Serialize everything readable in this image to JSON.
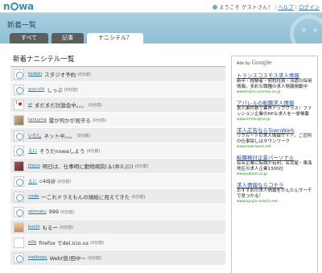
{
  "header": {
    "logo": "nowa",
    "greeting": "ようこそ ゲストさん！",
    "help_label": "ヘルプ",
    "login_label": "ログイン"
  },
  "band": {
    "title": "新着一覧"
  },
  "tabs": [
    {
      "label": "すべて"
    },
    {
      "label": "記事"
    },
    {
      "label": "ナニシテル？"
    }
  ],
  "main": {
    "section_title": "新着ナニシテル一覧",
    "items": [
      {
        "user": "todeki",
        "message": "スタジオ予約",
        "time": "(0分前)"
      },
      {
        "user": "yuu-chi",
        "message": "しっぷ",
        "time": "(0分前)"
      },
      {
        "user": "ai",
        "message": "まだまだ討論会中。。。",
        "time": "(0分前)"
      },
      {
        "user": "tatsuma",
        "message": "雷が何かが見守る",
        "time": "(0分前)"
      },
      {
        "user": "いわし",
        "message": "ネット中。。。",
        "time": "(0分前)"
      },
      {
        "user": "えに",
        "message": "そうだnowaしよう",
        "time": "(0分前)"
      },
      {
        "user": "jhoco",
        "message": "明日は、仕事明に動物病院(＆(弁)(ぷ))",
        "time": "(0分前)"
      },
      {
        "user": "えに",
        "message": "c4dj@",
        "time": "(0分前)"
      },
      {
        "user": "code",
        "message": "一これドラえもんの顔絵に見えてきた",
        "time": "(0分前)"
      },
      {
        "user": "akimaru",
        "message": "999",
        "time": "(0分前)"
      },
      {
        "user": "kochi",
        "message": "もるー",
        "time": "(0分前)"
      },
      {
        "user": "e0e",
        "message": "firefox でdel.icio.us",
        "time": "(0分前)"
      },
      {
        "user": "heiihoou",
        "message": "Web(仮)田中〜",
        "time": "(0分前)"
      }
    ]
  },
  "ads": {
    "header_prefix": "Ads by",
    "header_brand": "Google",
    "items": [
      {
        "title": "トランスコスモス求人情報",
        "body": "新卒・経験者・契約社員・派遣の採用情報。多彩な職種の求人情報掲載中",
        "url": "www.trans-cosmos.co.jp"
      },
      {
        "title": "アパレルの転職求人情報",
        "body": "求人案件数で業界トップクラス！ファッション企業のHP＆求人を一挙掲載",
        "url": "www.infoengine.jp"
      },
      {
        "title": "求人広告ならTownWork",
        "body": "リクルートの求人情報サイト。ご近所の仕事探しはタウンワーク",
        "url": "www.townwork.net"
      },
      {
        "title": "転職検討企業パーソナル",
        "body": "有名企業に転職が有利。名古屋・東海地区の求人企業1300社",
        "url": "www.jobaid.co.jp"
      },
      {
        "title": "求人情報ならコチラ",
        "body": "おすすめの求人情報をかんたんサーチで見つかる！",
        "url": "www.kyujin-search.net"
      }
    ]
  }
}
